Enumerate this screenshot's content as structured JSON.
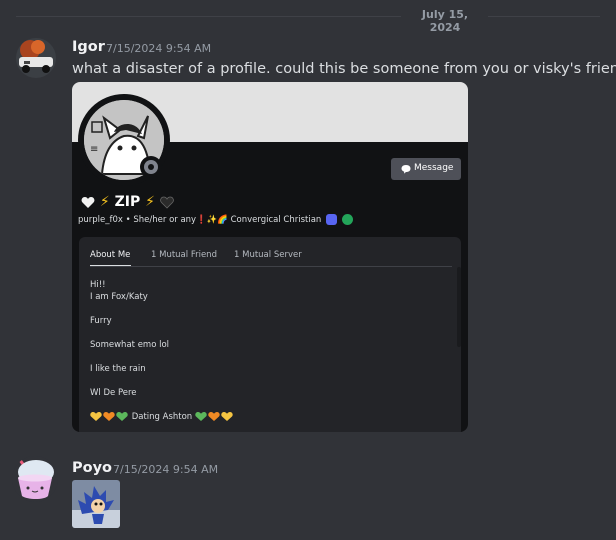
{
  "date_divider": "July 15, 2024",
  "messages": [
    {
      "author": "Igor",
      "timestamp": "7/15/2024 9:54 AM",
      "text": "what a disaster of a profile. could this be someone from you or visky's friends?",
      "avatar_icon": "fire-car-avatar"
    },
    {
      "author": "Poyo",
      "timestamp": "7/15/2024 9:54 AM",
      "avatar_icon": "bubble-tea-avatar",
      "attachment_icon": "sonic-image"
    }
  ],
  "profile_card": {
    "display_name": "ZIP",
    "username": "purple_f0x",
    "pronouns": "She/her or any",
    "separator": "•",
    "bio_tag": "Convergical Christian",
    "message_button": "Message",
    "tabs": [
      "About Me",
      "1 Mutual Friend",
      "1 Mutual Server"
    ],
    "about_lines": [
      "Hi!!",
      "I am Fox/Katy",
      "Furry",
      "Somewhat emo lol",
      "I like the rain",
      "Wl De Pere",
      "Dating Ashton"
    ],
    "colors": {
      "banner": "#e2e2e2",
      "card": "#111214",
      "inner": "#232428",
      "button": "#4e5058"
    }
  },
  "colors": {
    "background": "#313338",
    "text": "#dbdee1",
    "muted": "#949ba4"
  }
}
